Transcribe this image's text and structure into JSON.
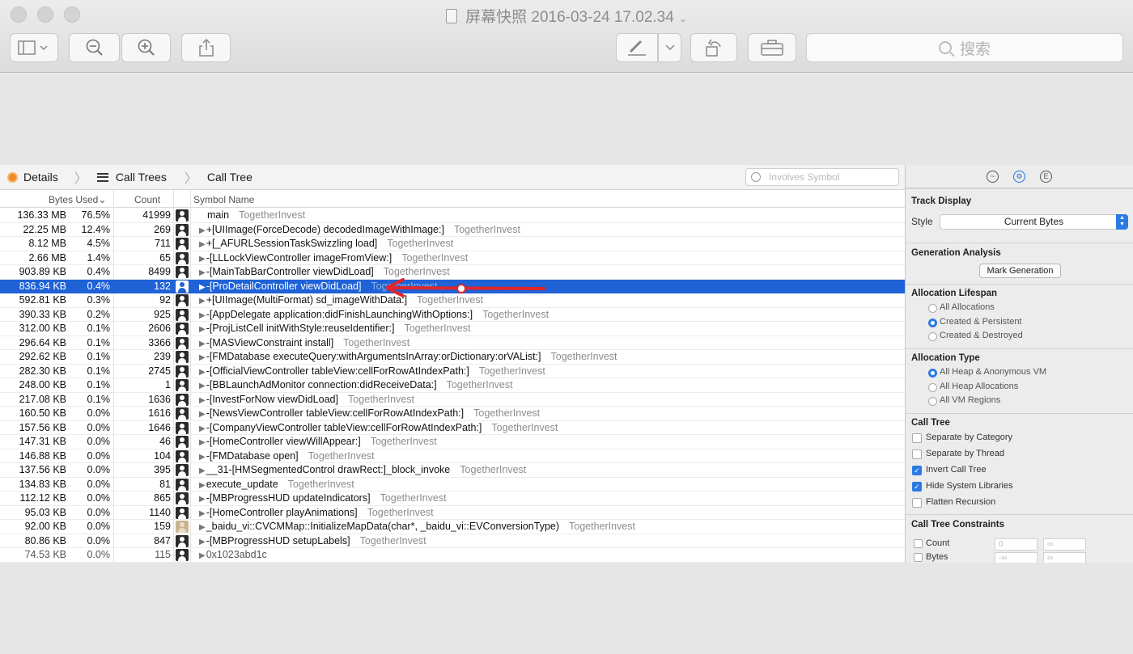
{
  "window": {
    "title": "屏幕快照 2016-03-24 17.02.34",
    "search_placeholder": "搜索"
  },
  "jumpbar": {
    "items": [
      "Details",
      "Call Trees",
      "Call Tree"
    ],
    "filter_placeholder": "Involves Symbol"
  },
  "table": {
    "headers": {
      "bytes": "Bytes Used",
      "count": "Count",
      "symbol": "Symbol Name"
    },
    "rows": [
      {
        "bytes": "136.33 MB",
        "pct": "76.5%",
        "count": "41999",
        "symbol": "main",
        "lib": "TogetherInvest",
        "disclosure": ""
      },
      {
        "bytes": "22.25 MB",
        "pct": "12.4%",
        "count": "269",
        "symbol": "+[UIImage(ForceDecode) decodedImageWithImage:]",
        "lib": "TogetherInvest",
        "disclosure": "▶"
      },
      {
        "bytes": "8.12 MB",
        "pct": "4.5%",
        "count": "711",
        "symbol": "+[_AFURLSessionTaskSwizzling load]",
        "lib": "TogetherInvest",
        "disclosure": "▶"
      },
      {
        "bytes": "2.66 MB",
        "pct": "1.4%",
        "count": "65",
        "symbol": "-[LLLockViewController imageFromView:]",
        "lib": "TogetherInvest",
        "disclosure": "▶"
      },
      {
        "bytes": "903.89 KB",
        "pct": "0.4%",
        "count": "8499",
        "symbol": "-[MainTabBarController viewDidLoad]",
        "lib": "TogetherInvest",
        "disclosure": "▶"
      },
      {
        "bytes": "836.94 KB",
        "pct": "0.4%",
        "count": "132",
        "symbol": "-[ProDetailController viewDidLoad]",
        "lib": "TogetherInvest",
        "disclosure": "▶"
      },
      {
        "bytes": "592.81 KB",
        "pct": "0.3%",
        "count": "92",
        "symbol": "+[UIImage(MultiFormat) sd_imageWithData:]",
        "lib": "TogetherInvest",
        "disclosure": "▶"
      },
      {
        "bytes": "390.33 KB",
        "pct": "0.2%",
        "count": "925",
        "symbol": "-[AppDelegate application:didFinishLaunchingWithOptions:]",
        "lib": "TogetherInvest",
        "disclosure": "▶"
      },
      {
        "bytes": "312.00 KB",
        "pct": "0.1%",
        "count": "2606",
        "symbol": "-[ProjListCell initWithStyle:reuseIdentifier:]",
        "lib": "TogetherInvest",
        "disclosure": "▶"
      },
      {
        "bytes": "296.64 KB",
        "pct": "0.1%",
        "count": "3366",
        "symbol": "-[MASViewConstraint install]",
        "lib": "TogetherInvest",
        "disclosure": "▶"
      },
      {
        "bytes": "292.62 KB",
        "pct": "0.1%",
        "count": "239",
        "symbol": "-[FMDatabase executeQuery:withArgumentsInArray:orDictionary:orVAList:]",
        "lib": "TogetherInvest",
        "disclosure": "▶"
      },
      {
        "bytes": "282.30 KB",
        "pct": "0.1%",
        "count": "2745",
        "symbol": "-[OfficialViewController tableView:cellForRowAtIndexPath:]",
        "lib": "TogetherInvest",
        "disclosure": "▶"
      },
      {
        "bytes": "248.00 KB",
        "pct": "0.1%",
        "count": "1",
        "symbol": "-[BBLaunchAdMonitor connection:didReceiveData:]",
        "lib": "TogetherInvest",
        "disclosure": "▶"
      },
      {
        "bytes": "217.08 KB",
        "pct": "0.1%",
        "count": "1636",
        "symbol": "-[InvestForNow viewDidLoad]",
        "lib": "TogetherInvest",
        "disclosure": "▶"
      },
      {
        "bytes": "160.50 KB",
        "pct": "0.0%",
        "count": "1616",
        "symbol": "-[NewsViewController tableView:cellForRowAtIndexPath:]",
        "lib": "TogetherInvest",
        "disclosure": "▶"
      },
      {
        "bytes": "157.56 KB",
        "pct": "0.0%",
        "count": "1646",
        "symbol": "-[CompanyViewController tableView:cellForRowAtIndexPath:]",
        "lib": "TogetherInvest",
        "disclosure": "▶"
      },
      {
        "bytes": "147.31 KB",
        "pct": "0.0%",
        "count": "46",
        "symbol": "-[HomeController viewWillAppear:]",
        "lib": "TogetherInvest",
        "disclosure": "▶"
      },
      {
        "bytes": "146.88 KB",
        "pct": "0.0%",
        "count": "104",
        "symbol": "-[FMDatabase open]",
        "lib": "TogetherInvest",
        "disclosure": "▶"
      },
      {
        "bytes": "137.56 KB",
        "pct": "0.0%",
        "count": "395",
        "symbol": "__31-[HMSegmentedControl drawRect:]_block_invoke",
        "lib": "TogetherInvest",
        "disclosure": "▶"
      },
      {
        "bytes": "134.83 KB",
        "pct": "0.0%",
        "count": "81",
        "symbol": "execute_update",
        "lib": "TogetherInvest",
        "disclosure": "▶"
      },
      {
        "bytes": "112.12 KB",
        "pct": "0.0%",
        "count": "865",
        "symbol": "-[MBProgressHUD updateIndicators]",
        "lib": "TogetherInvest",
        "disclosure": "▶"
      },
      {
        "bytes": "95.03 KB",
        "pct": "0.0%",
        "count": "1140",
        "symbol": "-[HomeController playAnimations]",
        "lib": "TogetherInvest",
        "disclosure": "▶"
      },
      {
        "bytes": "92.00 KB",
        "pct": "0.0%",
        "count": "159",
        "symbol": "_baidu_vi::CVCMMap::InitializeMapData(char*, _baidu_vi::EVConversionType)",
        "lib": "TogetherInvest",
        "disclosure": "▶"
      },
      {
        "bytes": "80.86 KB",
        "pct": "0.0%",
        "count": "847",
        "symbol": "-[MBProgressHUD setupLabels]",
        "lib": "TogetherInvest",
        "disclosure": "▶"
      },
      {
        "bytes": "74.53 KB",
        "pct": "0.0%",
        "count": "115",
        "symbol": "0x1023abd1c",
        "lib": "",
        "disclosure": "▶"
      }
    ]
  },
  "inspector": {
    "track_display": {
      "title": "Track Display",
      "style_label": "Style",
      "style_value": "Current Bytes"
    },
    "generation": {
      "title": "Generation Analysis",
      "button": "Mark Generation"
    },
    "lifespan": {
      "title": "Allocation Lifespan",
      "options": [
        "All Allocations",
        "Created & Persistent",
        "Created & Destroyed"
      ]
    },
    "alloc_type": {
      "title": "Allocation Type",
      "options": [
        "All Heap & Anonymous VM",
        "All Heap Allocations",
        "All VM Regions"
      ]
    },
    "call_tree": {
      "title": "Call Tree",
      "options": [
        "Separate by Category",
        "Separate by Thread",
        "Invert Call Tree",
        "Hide System Libraries",
        "Flatten Recursion"
      ]
    },
    "constraints": {
      "title": "Call Tree Constraints",
      "count_label": "Count",
      "bytes_label": "Bytes",
      "count_min": "0",
      "count_max": "∞",
      "bytes_min": "-∞",
      "bytes_max": "∞"
    }
  },
  "colors": {
    "selection": "#1f62d6",
    "arrow": "#e0262a",
    "accent": "#2a7ae2"
  }
}
